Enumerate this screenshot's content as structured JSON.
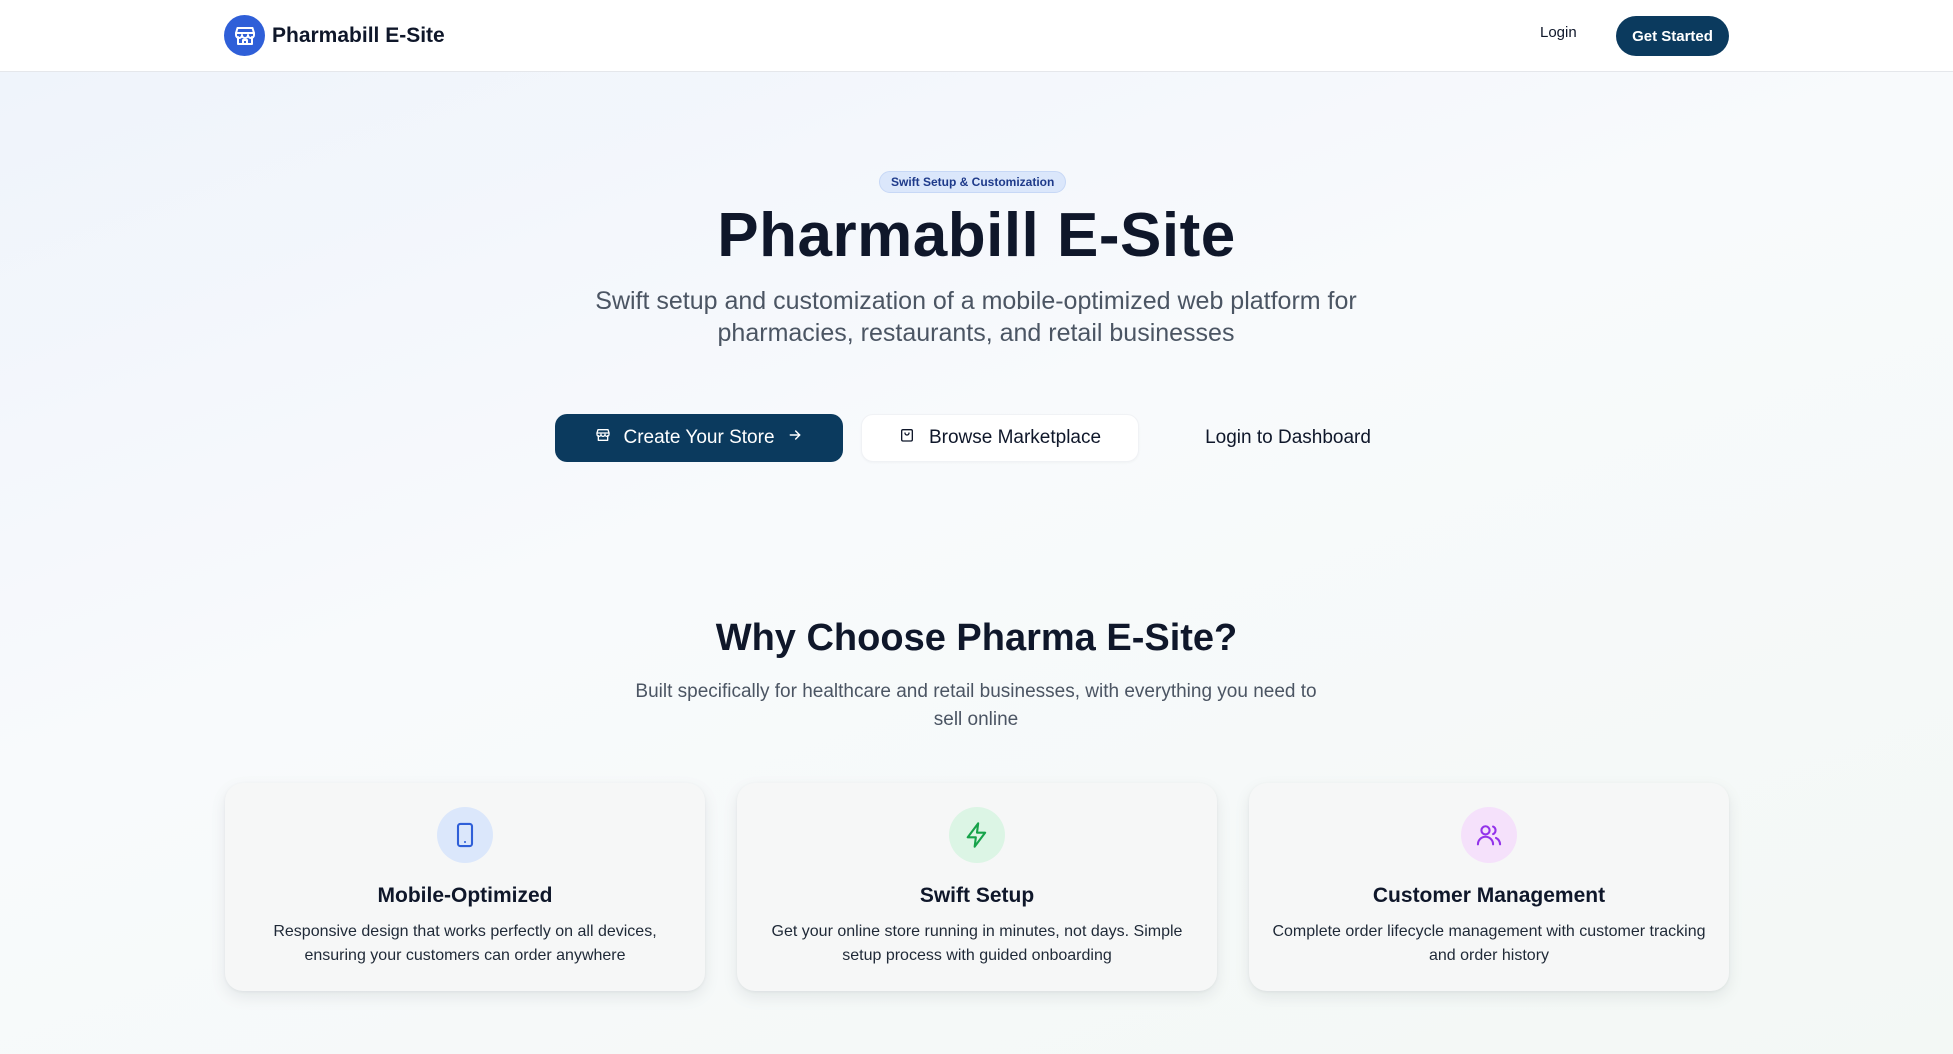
{
  "header": {
    "brand_name": "Pharmabill E-Site",
    "login_label": "Login",
    "cta_label": "Get Started"
  },
  "hero": {
    "badge": "Swift Setup & Customization",
    "title": "Pharmabill E-Site",
    "subtitle": "Swift setup and customization of a mobile-optimized web platform for pharmacies, restaurants, and retail businesses",
    "buttons": {
      "create_store": "Create Your Store",
      "browse_marketplace": "Browse Marketplace",
      "login_dashboard": "Login to Dashboard"
    }
  },
  "why": {
    "title": "Why Choose Pharma E-Site?",
    "subtitle": "Built specifically for healthcare and retail businesses, with everything you need to sell online"
  },
  "features": [
    {
      "icon": "smartphone-icon",
      "title": "Mobile-Optimized",
      "description": "Responsive design that works perfectly on all devices, ensuring your customers can order anywhere"
    },
    {
      "icon": "lightning-icon",
      "title": "Swift Setup",
      "description": "Get your online store running in minutes, not days. Simple setup process with guided onboarding"
    },
    {
      "icon": "users-icon",
      "title": "Customer Management",
      "description": "Complete order lifecycle management with customer tracking and order history"
    }
  ],
  "colors": {
    "brand_blue": "#2f5fd8",
    "primary_navy": "#0b3a5e",
    "mobile_icon_bg": "#dbe7fb",
    "setup_icon_bg": "#dcf5e5",
    "customer_icon_bg": "#f5e1fb"
  }
}
